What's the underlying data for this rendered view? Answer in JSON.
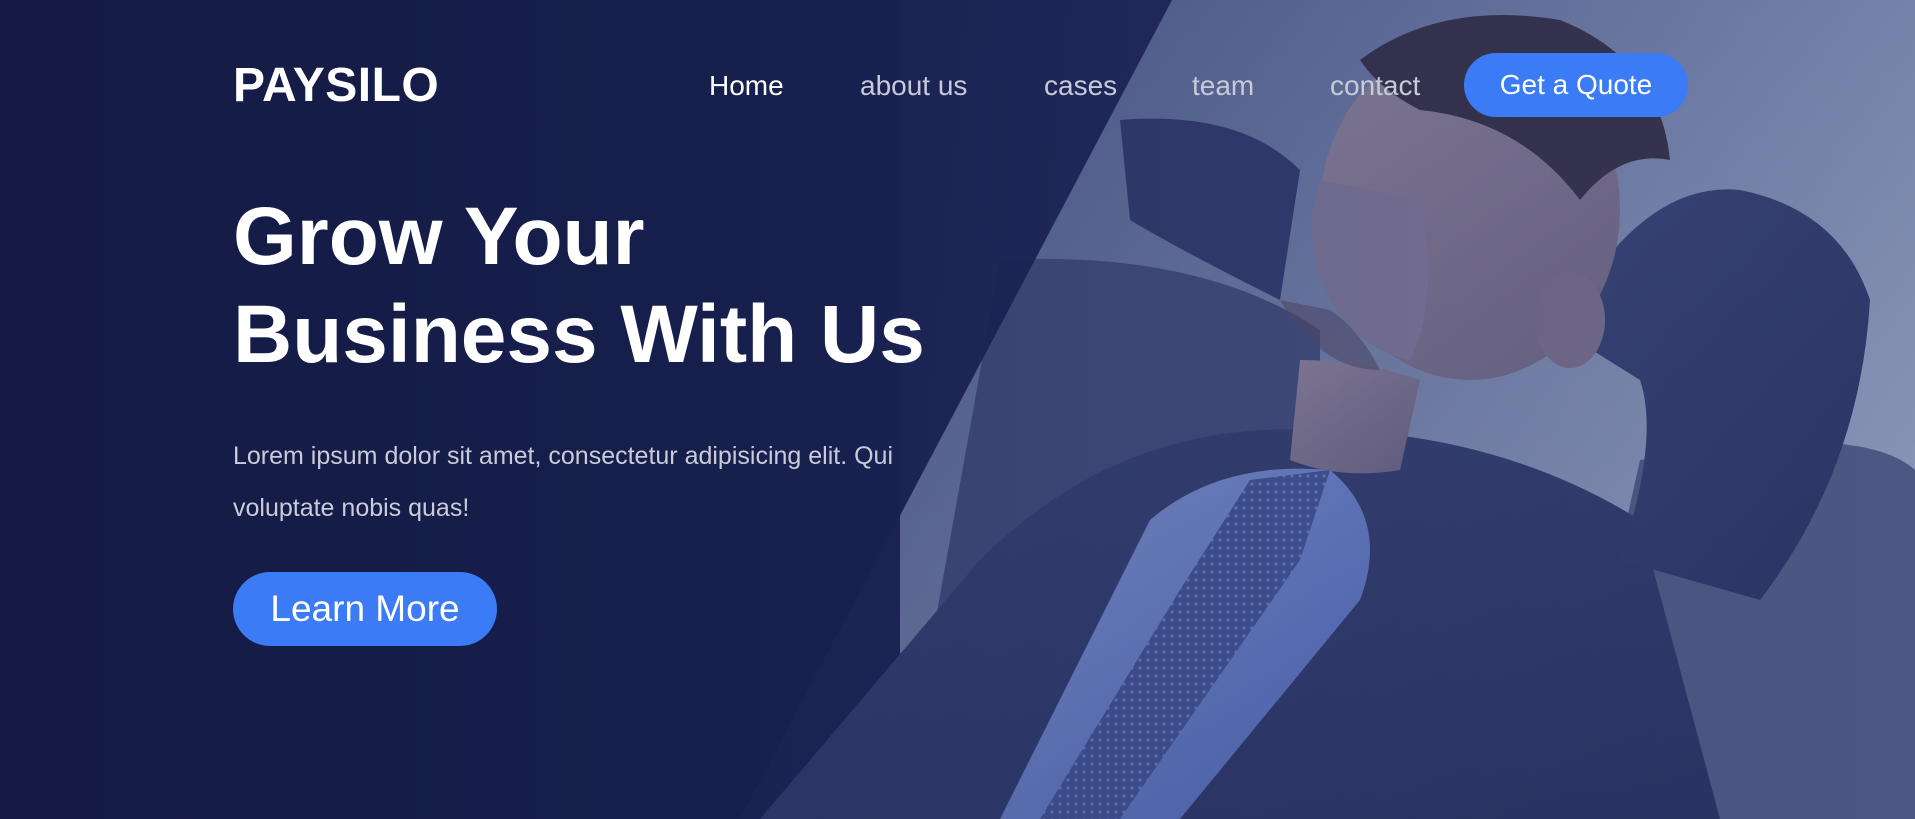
{
  "brand": {
    "name": "PAYSILO"
  },
  "nav": {
    "items": [
      {
        "label": "Home",
        "active": true
      },
      {
        "label": "about us",
        "active": false
      },
      {
        "label": "cases",
        "active": false
      },
      {
        "label": "team",
        "active": false
      },
      {
        "label": "contact",
        "active": false
      }
    ],
    "cta_label": "Get a Quote"
  },
  "hero": {
    "headline_line1": "Grow Your",
    "headline_line2": "Business With Us",
    "lead": "Lorem ipsum dolor sit amet, consectetur adipisicing elit. Qui voluptate nobis quas!",
    "button_label": "Learn More",
    "image": "businessman-relaxing-photo"
  },
  "colors": {
    "background": "#161d45",
    "accent": "#3b7bf5",
    "text_primary": "#ffffff",
    "text_muted": "#c7cad8"
  }
}
